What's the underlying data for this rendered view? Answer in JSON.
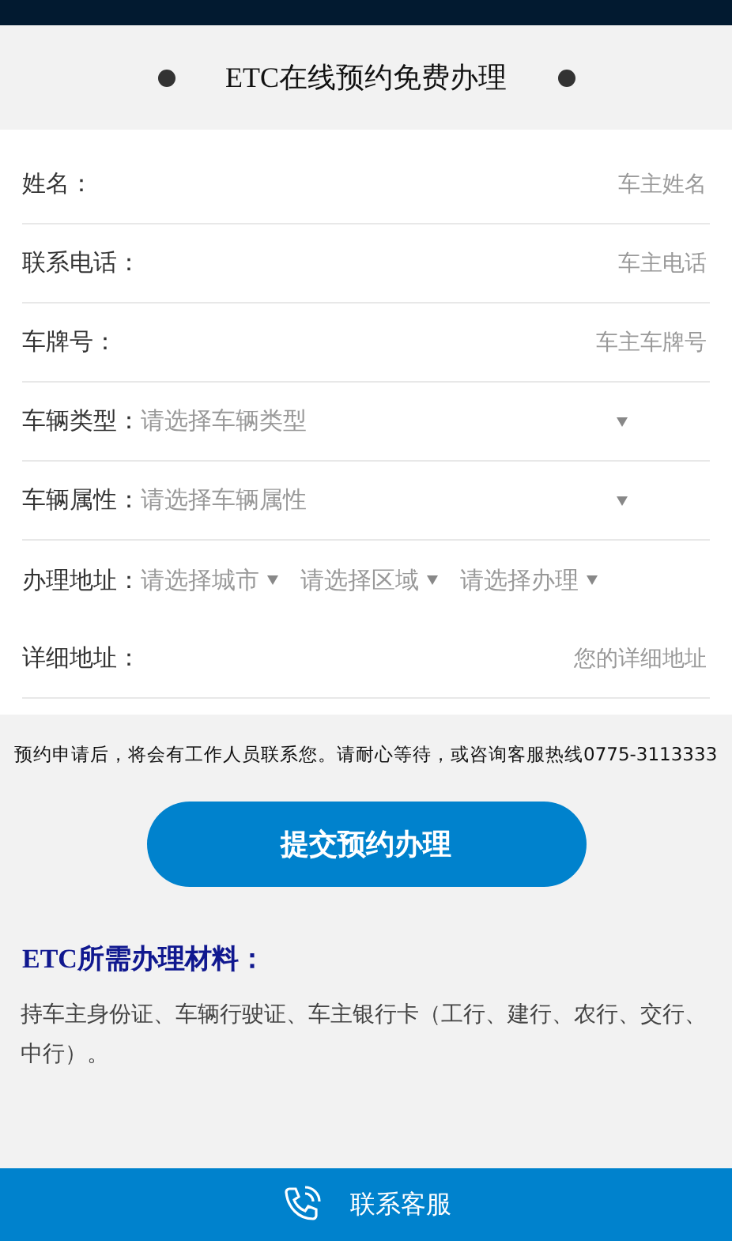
{
  "header": {
    "title": "ETC在线预约免费办理"
  },
  "form": [
    {
      "kind": "input",
      "label": "姓名：",
      "placeholder": "车主姓名"
    },
    {
      "kind": "input",
      "label": "联系电话：",
      "placeholder": "车主电话"
    },
    {
      "kind": "input",
      "label": "车牌号：",
      "placeholder": "车主车牌号"
    },
    {
      "kind": "select",
      "label": "车辆类型：",
      "options": [
        "请选择车辆类型"
      ]
    },
    {
      "kind": "select",
      "label": "车辆属性：",
      "options": [
        "请选择车辆属性"
      ]
    },
    {
      "kind": "multi",
      "label": "办理地址：",
      "options": [
        "请选择城市",
        "请选择区域",
        "请选择办理"
      ]
    },
    {
      "kind": "input",
      "label": "详细地址：",
      "placeholder": "您的详细地址"
    }
  ],
  "notice": "预约申请后，将会有工作人员联系您。请耐心等待，或咨询客服热线0775-3113333",
  "submit_button": "提交预约办理",
  "materials": {
    "title": "ETC所需办理材料：",
    "text": "持车主身份证、车辆行驶证、车主银行卡（工行、建行、农行、交行、中行）。"
  },
  "footer": {
    "label": "联系客服"
  }
}
